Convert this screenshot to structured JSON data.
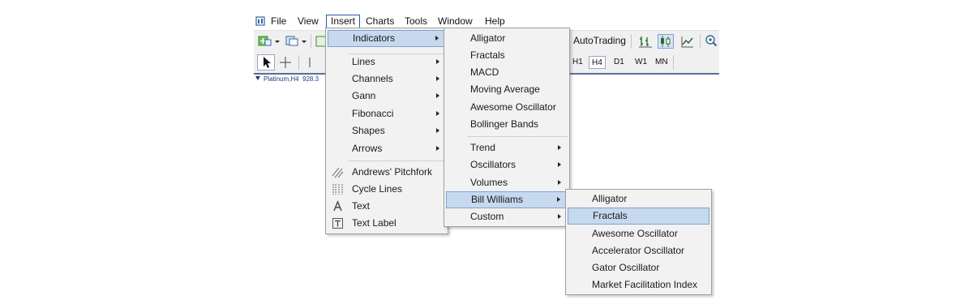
{
  "menubar": {
    "items": [
      "File",
      "View",
      "Insert",
      "Charts",
      "Tools",
      "Window",
      "Help"
    ]
  },
  "toolbar": {
    "autotrading_label": "AutoTrading",
    "timeframes": [
      "H1",
      "H4",
      "D1",
      "W1",
      "MN"
    ],
    "selected_timeframe": "H4"
  },
  "chart": {
    "symbol_label": "Platinum,H4",
    "price_partial": "928.3"
  },
  "insert_menu": {
    "group1": [
      {
        "label": "Indicators"
      }
    ],
    "group2": [
      {
        "label": "Lines"
      },
      {
        "label": "Channels"
      },
      {
        "label": "Gann"
      },
      {
        "label": "Fibonacci"
      },
      {
        "label": "Shapes"
      },
      {
        "label": "Arrows"
      }
    ],
    "group3": [
      {
        "label": "Andrews' Pitchfork",
        "icon": "pitchfork-icon"
      },
      {
        "label": "Cycle Lines",
        "icon": "cycle-lines-icon"
      },
      {
        "label": "Text",
        "icon": "text-icon"
      },
      {
        "label": "Text Label",
        "icon": "text-label-icon"
      }
    ]
  },
  "indicators_menu": {
    "group1": [
      "Alligator",
      "Fractals",
      "MACD",
      "Moving Average",
      "Awesome Oscillator",
      "Bollinger Bands"
    ],
    "group2": [
      "Trend",
      "Oscillators",
      "Volumes",
      "Bill Williams",
      "Custom"
    ]
  },
  "bill_williams_menu": {
    "items": [
      "Alligator",
      "Fractals",
      "Awesome Oscillator",
      "Accelerator Oscillator",
      "Gator Oscillator",
      "Market Facilitation Index"
    ]
  },
  "colors": {
    "highlight": "#c6d9ee",
    "highlight_border": "#7fa3cf",
    "menu_bg": "#f2f2f2"
  }
}
